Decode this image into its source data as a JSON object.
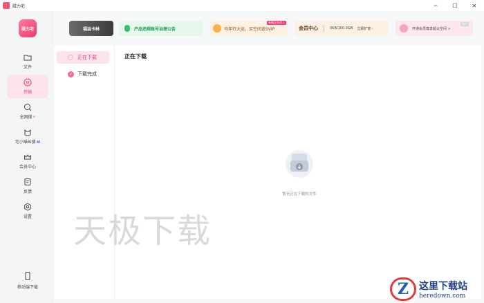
{
  "window": {
    "title": "磁力宅",
    "controls": {
      "minimize": "─",
      "maximize": "☐",
      "close": "✕"
    }
  },
  "sidebar": {
    "logo_text": "磁力宅",
    "items": [
      {
        "label": "文件",
        "icon": "folder-icon"
      },
      {
        "label": "传输",
        "icon": "pause-circle-icon",
        "active": true
      },
      {
        "label": "全网搜",
        "icon": "search-icon",
        "badge": "⚡"
      },
      {
        "label": "宅小喵AI搜",
        "icon": "cat-icon",
        "badge": "AI"
      },
      {
        "label": "会员中心",
        "icon": "crown-icon"
      },
      {
        "label": "反馈",
        "icon": "feedback-icon"
      },
      {
        "label": "设置",
        "icon": "gear-icon"
      }
    ],
    "bottom_item": {
      "label": "移动端下载",
      "icon": "phone-icon"
    }
  },
  "banners": {
    "card": "福运卡林",
    "notice": "产品违规账号治理公告",
    "vip": {
      "text": "马年行大运，买空间送SVIP",
      "tag": "有福正在进入"
    },
    "member": {
      "title": "会员中心",
      "storage": "0KB/100.0GB",
      "cta": "立即扩容 ›"
    },
    "promo": {
      "text": "开通会员尊享超大空间 >",
      "tag": "限时"
    }
  },
  "transfer": {
    "tabs": [
      {
        "label": "正在下载",
        "active": true
      },
      {
        "label": "下载完成",
        "active": false
      }
    ],
    "panel_title": "正在下载",
    "empty_text": "暂无正在下载的文件"
  },
  "watermark": {
    "text": "天极下载",
    "site_cn": "这里下载站",
    "site_en": "heredown.com",
    "logo_letter": "Z"
  },
  "colors": {
    "accent": "#f1386d",
    "accent_light": "#fde4ea"
  }
}
